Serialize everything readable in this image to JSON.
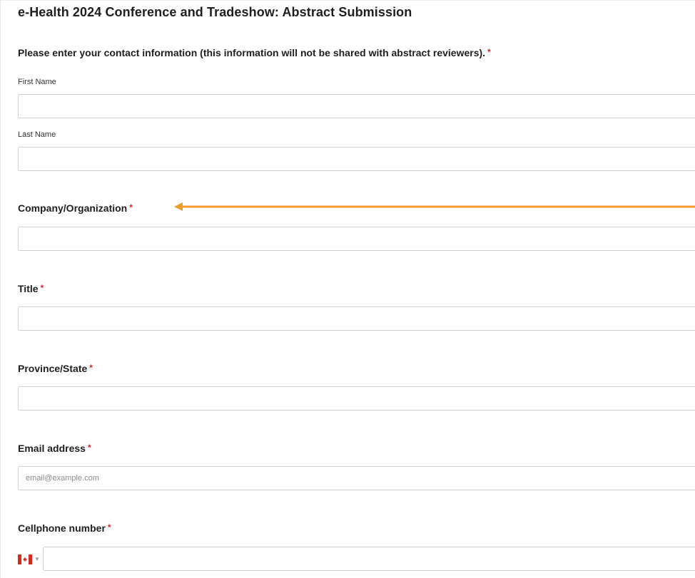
{
  "form": {
    "title": "e-Health 2024 Conference and Tradeshow: Abstract Submission"
  },
  "contact": {
    "question": "Please enter your contact information (this information will not be shared with abstract reviewers).",
    "required_mark": "*",
    "first_name_label": "First Name",
    "first_name_value": "",
    "last_name_label": "Last Name",
    "last_name_value": ""
  },
  "company": {
    "label": "Company/Organization",
    "required_mark": "*",
    "value": "",
    "annotation_arrow_color": "#f39a2c"
  },
  "title_field": {
    "label": "Title",
    "required_mark": "*",
    "value": ""
  },
  "province": {
    "label": "Province/State",
    "required_mark": "*",
    "value": ""
  },
  "email": {
    "label": "Email address",
    "required_mark": "*",
    "placeholder": "email@example.com",
    "value": ""
  },
  "cellphone": {
    "label": "Cellphone number",
    "required_mark": "*",
    "country_flag_icon": "canada-flag-icon",
    "value": ""
  },
  "colors": {
    "required": "#d6262a",
    "border": "#cfcfcf",
    "text": "#1f1f1f"
  }
}
